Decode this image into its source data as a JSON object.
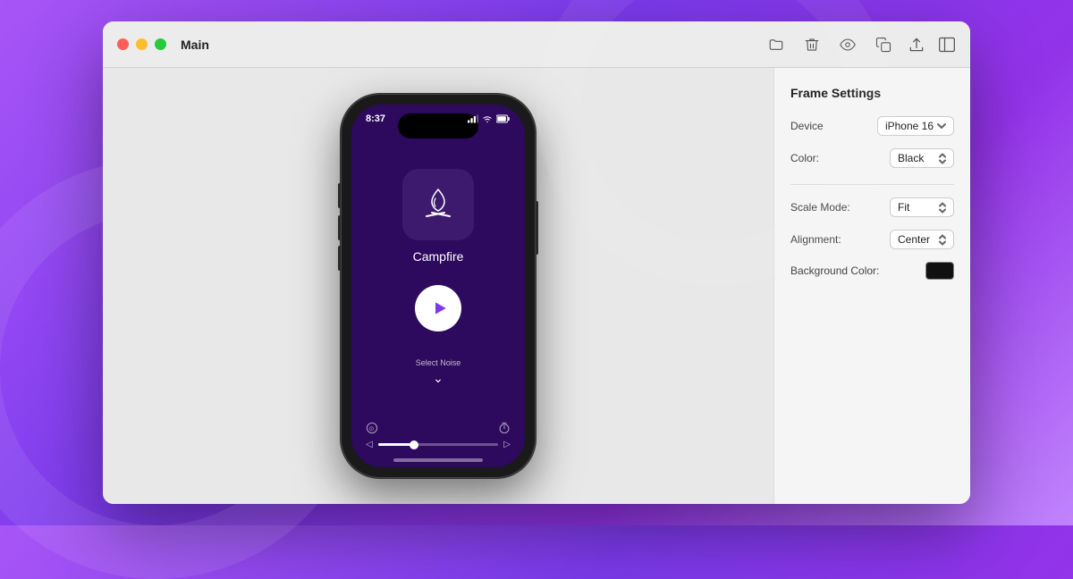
{
  "window": {
    "title": "Main"
  },
  "toolbar": {
    "icons": [
      "folder-icon",
      "trash-icon",
      "eye-icon",
      "copy-icon"
    ],
    "right_icons": [
      "share-icon",
      "sidebar-icon"
    ]
  },
  "canvas": {
    "phone": {
      "time": "8:37",
      "app_name": "Campfire",
      "select_noise": "Select Noise"
    }
  },
  "panel": {
    "title": "Frame Settings",
    "device_label": "Device",
    "device_value": "iPhone 16",
    "color_label": "Color:",
    "color_value": "Black",
    "scale_label": "Scale Mode:",
    "scale_value": "Fit",
    "alignment_label": "Alignment:",
    "alignment_value": "Center",
    "bg_color_label": "Background Color:",
    "bg_color_value": "#111111"
  }
}
